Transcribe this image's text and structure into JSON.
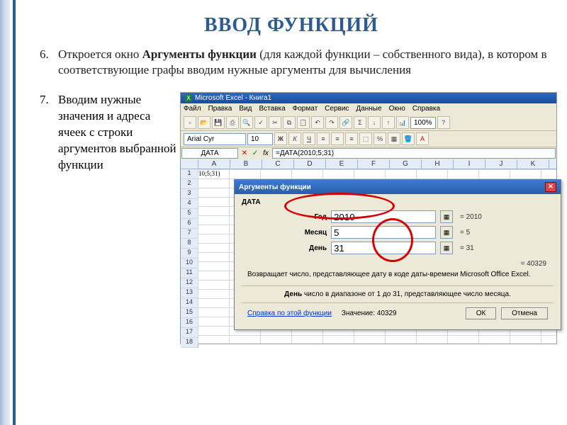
{
  "title": "ВВОД ФУНКЦИЙ",
  "item6": {
    "num": "6.",
    "text_pre": "Откроется окно ",
    "bold": "Аргументы функции",
    "text_post": " (для каждой функции – собственного вида), в котором в соответствующие графы вводим нужные аргументы для вычисления"
  },
  "item7": {
    "num": "7.",
    "text": "Вводим нужные значения и адреса ячеек с строки аргументов выбранной функции"
  },
  "excel": {
    "app_title": "Microsoft Excel - Книга1",
    "menu": [
      "Файл",
      "Правка",
      "Вид",
      "Вставка",
      "Формат",
      "Сервис",
      "Данные",
      "Окно",
      "Справка"
    ],
    "font": "Arial Cyr",
    "fontsize": "10",
    "zoom": "100%",
    "namebox": "ДАТА",
    "formula": "=ДАТА(2010;5;31)",
    "cols": [
      "",
      "A",
      "B",
      "C",
      "D",
      "E",
      "F",
      "G",
      "H",
      "I",
      "J",
      "K"
    ],
    "cellA1": "10;5;31)"
  },
  "dialog": {
    "title": "Аргументы функции",
    "fn": "ДАТА",
    "fields": [
      {
        "label": "Год",
        "value": "2010",
        "result": "= 2010"
      },
      {
        "label": "Месяц",
        "value": "5",
        "result": "= 5"
      },
      {
        "label": "День",
        "value": "31",
        "result": "= 31"
      }
    ],
    "calc": "= 40329",
    "desc": "Возвращает число, представляющее дату в коде даты-времени Microsoft Office Excel.",
    "field_help_label": "День",
    "field_help": "число в диапазоне от 1 до 31, представляющее число месяца.",
    "help_link": "Справка по этой функции",
    "value_label": "Значение:",
    "value": "40329",
    "ok": "ОК",
    "cancel": "Отмена"
  }
}
